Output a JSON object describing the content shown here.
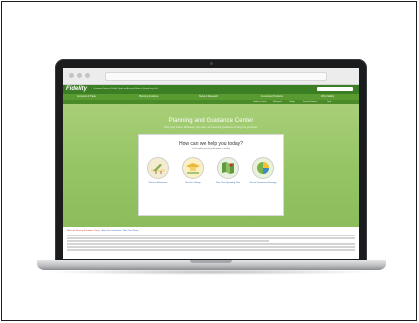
{
  "site": {
    "logo": "Fidelity",
    "top_links": "Customer Service   Profile   Open an Account   Refer a Friend   Log Out",
    "nav_items": [
      "Accounts & Trade",
      "Planning & Advice",
      "News & Research",
      "Investment Products",
      "Why Fidelity"
    ],
    "subnav_items": [
      "Guidance Center",
      "Retirement",
      "College",
      "Personal Finance",
      "Tools"
    ]
  },
  "hero": {
    "title": "Planning and Guidance Center",
    "subtitle": "Plan your future. Whatever you want, we have the guidance to help you get there.",
    "card_title": "How can we help you today?",
    "card_subtitle": "Let's make your key decisions a reality",
    "options": [
      {
        "label": "Plan for Retirement",
        "icon": "beach-chair-icon",
        "color": "#f2dfa6"
      },
      {
        "label": "Plan for College",
        "icon": "graduation-cap-icon",
        "color": "#f6d36a"
      },
      {
        "label": "Plan Your Spending Plan",
        "icon": "map-icon",
        "color": "#d9e8cd"
      },
      {
        "label": "Get an Investment Strategy",
        "icon": "pie-chart-icon",
        "color": "#d4e7b0"
      }
    ]
  },
  "content": {
    "links": [
      "Watch the Planning & Guidance Center",
      "About Your Investments",
      "More Than Money"
    ]
  },
  "colors": {
    "brand_dark": "#3b7e24",
    "brand_mid": "#5a9b31",
    "hero": "#95c464",
    "link": "#3b6fb6"
  }
}
